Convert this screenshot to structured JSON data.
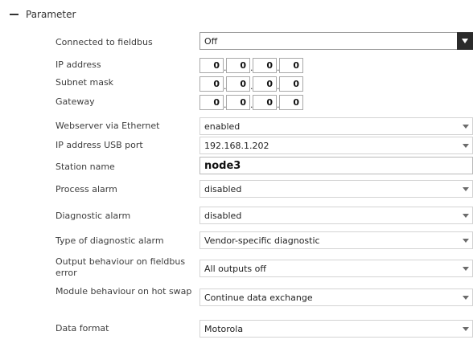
{
  "section": {
    "title": "Parameter",
    "icon": "minus-icon"
  },
  "rows": {
    "fieldbus": {
      "label": "Connected to fieldbus",
      "value": "Off"
    },
    "ip": {
      "label": "IP address",
      "octets": [
        "0",
        "0",
        "0",
        "0"
      ]
    },
    "subnet": {
      "label": "Subnet mask",
      "octets": [
        "0",
        "0",
        "0",
        "0"
      ]
    },
    "gateway": {
      "label": "Gateway",
      "octets": [
        "0",
        "0",
        "0",
        "0"
      ]
    },
    "webserver": {
      "label": "Webserver via Ethernet",
      "value": "enabled"
    },
    "usb_ip": {
      "label": "IP address USB port",
      "value": "192.168.1.202"
    },
    "station": {
      "label": "Station name",
      "value": "node3"
    },
    "process_alarm": {
      "label": "Process alarm",
      "value": "disabled"
    },
    "diag_alarm": {
      "label": "Diagnostic alarm",
      "value": "disabled"
    },
    "diag_type": {
      "label": "Type of diagnostic alarm",
      "value": "Vendor-specific diagnostic"
    },
    "output_behaviour": {
      "label": "Output behaviour on fieldbus error",
      "value": "All outputs off"
    },
    "module_behaviour": {
      "label": "Module behaviour on hot swap",
      "value": "Continue data exchange"
    },
    "data_format": {
      "label": "Data format",
      "value": "Motorola"
    }
  }
}
